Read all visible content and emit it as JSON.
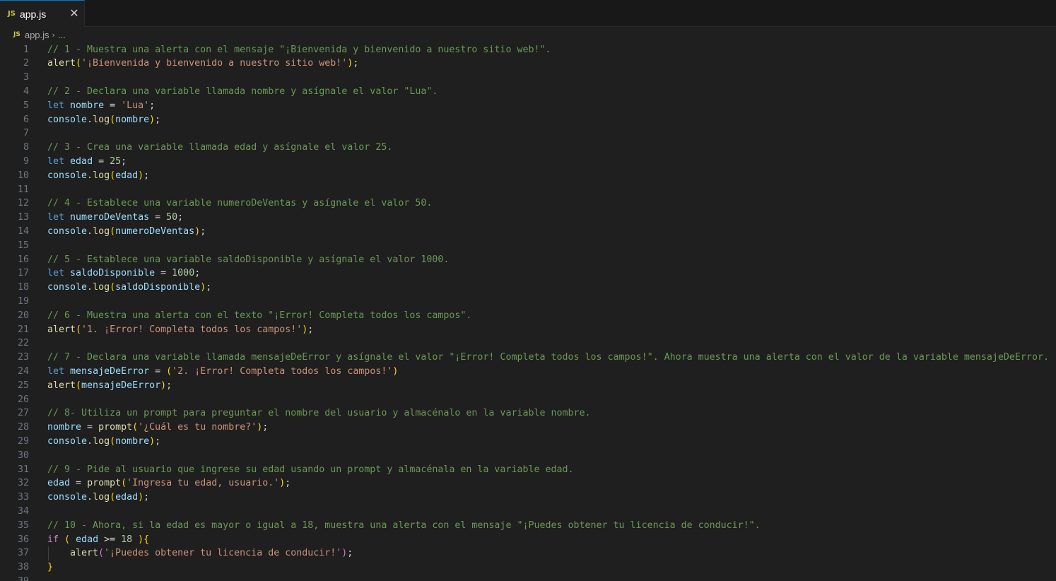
{
  "tab": {
    "badge": "JS",
    "filename": "app.js",
    "close": "✕"
  },
  "breadcrumb": {
    "badge": "JS",
    "file": "app.js",
    "separator": "›",
    "more": "..."
  },
  "code_lines": [
    {
      "n": "1",
      "tokens": [
        [
          "cm",
          "// 1 - Muestra una alerta con el mensaje \"¡Bienvenida y bienvenido a nuestro sitio web!\"."
        ]
      ]
    },
    {
      "n": "2",
      "tokens": [
        [
          "fn",
          "alert"
        ],
        [
          "b1",
          "("
        ],
        [
          "str",
          "'¡Bienvenida y bienvenido a nuestro sitio web!'"
        ],
        [
          "b1",
          ")"
        ],
        [
          "op",
          ";"
        ]
      ]
    },
    {
      "n": "3",
      "tokens": []
    },
    {
      "n": "4",
      "tokens": [
        [
          "cm",
          "// 2 - Declara una variable llamada nombre y asígnale el valor \"Lua\"."
        ]
      ]
    },
    {
      "n": "5",
      "tokens": [
        [
          "kw",
          "let"
        ],
        [
          "op",
          " "
        ],
        [
          "var",
          "nombre"
        ],
        [
          "op",
          " = "
        ],
        [
          "str",
          "'Lua'"
        ],
        [
          "op",
          ";"
        ]
      ]
    },
    {
      "n": "6",
      "tokens": [
        [
          "var",
          "console"
        ],
        [
          "op",
          "."
        ],
        [
          "fn",
          "log"
        ],
        [
          "b1",
          "("
        ],
        [
          "var",
          "nombre"
        ],
        [
          "b1",
          ")"
        ],
        [
          "op",
          ";"
        ]
      ]
    },
    {
      "n": "7",
      "tokens": []
    },
    {
      "n": "8",
      "tokens": [
        [
          "cm",
          "// 3 - Crea una variable llamada edad y asígnale el valor 25."
        ]
      ]
    },
    {
      "n": "9",
      "tokens": [
        [
          "kw",
          "let"
        ],
        [
          "op",
          " "
        ],
        [
          "var",
          "edad"
        ],
        [
          "op",
          " = "
        ],
        [
          "num",
          "25"
        ],
        [
          "op",
          ";"
        ]
      ]
    },
    {
      "n": "10",
      "tokens": [
        [
          "var",
          "console"
        ],
        [
          "op",
          "."
        ],
        [
          "fn",
          "log"
        ],
        [
          "b1",
          "("
        ],
        [
          "var",
          "edad"
        ],
        [
          "b1",
          ")"
        ],
        [
          "op",
          ";"
        ]
      ]
    },
    {
      "n": "11",
      "tokens": []
    },
    {
      "n": "12",
      "tokens": [
        [
          "cm",
          "// 4 - Establece una variable numeroDeVentas y asígnale el valor 50."
        ]
      ]
    },
    {
      "n": "13",
      "tokens": [
        [
          "kw",
          "let"
        ],
        [
          "op",
          " "
        ],
        [
          "var",
          "numeroDeVentas"
        ],
        [
          "op",
          " = "
        ],
        [
          "num",
          "50"
        ],
        [
          "op",
          ";"
        ]
      ]
    },
    {
      "n": "14",
      "tokens": [
        [
          "var",
          "console"
        ],
        [
          "op",
          "."
        ],
        [
          "fn",
          "log"
        ],
        [
          "b1",
          "("
        ],
        [
          "var",
          "numeroDeVentas"
        ],
        [
          "b1",
          ")"
        ],
        [
          "op",
          ";"
        ]
      ]
    },
    {
      "n": "15",
      "tokens": []
    },
    {
      "n": "16",
      "tokens": [
        [
          "cm",
          "// 5 - Establece una variable saldoDisponible y asígnale el valor 1000."
        ]
      ]
    },
    {
      "n": "17",
      "tokens": [
        [
          "kw",
          "let"
        ],
        [
          "op",
          " "
        ],
        [
          "var",
          "saldoDisponible"
        ],
        [
          "op",
          " = "
        ],
        [
          "num",
          "1000"
        ],
        [
          "op",
          ";"
        ]
      ]
    },
    {
      "n": "18",
      "tokens": [
        [
          "var",
          "console"
        ],
        [
          "op",
          "."
        ],
        [
          "fn",
          "log"
        ],
        [
          "b1",
          "("
        ],
        [
          "var",
          "saldoDisponible"
        ],
        [
          "b1",
          ")"
        ],
        [
          "op",
          ";"
        ]
      ]
    },
    {
      "n": "19",
      "tokens": []
    },
    {
      "n": "20",
      "tokens": [
        [
          "cm",
          "// 6 - Muestra una alerta con el texto \"¡Error! Completa todos los campos\"."
        ]
      ]
    },
    {
      "n": "21",
      "tokens": [
        [
          "fn",
          "alert"
        ],
        [
          "b1",
          "("
        ],
        [
          "str",
          "'1. ¡Error! Completa todos los campos!'"
        ],
        [
          "b1",
          ")"
        ],
        [
          "op",
          ";"
        ]
      ]
    },
    {
      "n": "22",
      "tokens": []
    },
    {
      "n": "23",
      "tokens": [
        [
          "cm",
          "// 7 - Declara una variable llamada mensajeDeError y asígnale el valor \"¡Error! Completa todos los campos!\". Ahora muestra una alerta con el valor de la variable mensajeDeError."
        ]
      ]
    },
    {
      "n": "24",
      "tokens": [
        [
          "kw",
          "let"
        ],
        [
          "op",
          " "
        ],
        [
          "var",
          "mensajeDeError"
        ],
        [
          "op",
          " = "
        ],
        [
          "b1",
          "("
        ],
        [
          "str",
          "'2. ¡Error! Completa todos los campos!'"
        ],
        [
          "b1",
          ")"
        ]
      ]
    },
    {
      "n": "25",
      "tokens": [
        [
          "fn",
          "alert"
        ],
        [
          "b1",
          "("
        ],
        [
          "var",
          "mensajeDeError"
        ],
        [
          "b1",
          ")"
        ],
        [
          "op",
          ";"
        ]
      ]
    },
    {
      "n": "26",
      "tokens": []
    },
    {
      "n": "27",
      "tokens": [
        [
          "cm",
          "// 8- Utiliza un prompt para preguntar el nombre del usuario y almacénalo en la variable nombre."
        ]
      ]
    },
    {
      "n": "28",
      "tokens": [
        [
          "var",
          "nombre"
        ],
        [
          "op",
          " = "
        ],
        [
          "fn",
          "prompt"
        ],
        [
          "b1",
          "("
        ],
        [
          "str",
          "'¿Cuál es tu nombre?'"
        ],
        [
          "b1",
          ")"
        ],
        [
          "op",
          ";"
        ]
      ]
    },
    {
      "n": "29",
      "tokens": [
        [
          "var",
          "console"
        ],
        [
          "op",
          "."
        ],
        [
          "fn",
          "log"
        ],
        [
          "b1",
          "("
        ],
        [
          "var",
          "nombre"
        ],
        [
          "b1",
          ")"
        ],
        [
          "op",
          ";"
        ]
      ]
    },
    {
      "n": "30",
      "tokens": []
    },
    {
      "n": "31",
      "tokens": [
        [
          "cm",
          "// 9 - Pide al usuario que ingrese su edad usando un prompt y almacénala en la variable edad."
        ]
      ]
    },
    {
      "n": "32",
      "tokens": [
        [
          "var",
          "edad"
        ],
        [
          "op",
          " = "
        ],
        [
          "fn",
          "prompt"
        ],
        [
          "b1",
          "("
        ],
        [
          "str",
          "'Ingresa tu edad, usuario.'"
        ],
        [
          "b1",
          ")"
        ],
        [
          "op",
          ";"
        ]
      ]
    },
    {
      "n": "33",
      "tokens": [
        [
          "var",
          "console"
        ],
        [
          "op",
          "."
        ],
        [
          "fn",
          "log"
        ],
        [
          "b1",
          "("
        ],
        [
          "var",
          "edad"
        ],
        [
          "b1",
          ")"
        ],
        [
          "op",
          ";"
        ]
      ]
    },
    {
      "n": "34",
      "tokens": []
    },
    {
      "n": "35",
      "tokens": [
        [
          "cm",
          "// 10 - Ahora, si la edad es mayor o igual a 18, muestra una alerta con el mensaje \"¡Puedes obtener tu licencia de conducir!\"."
        ]
      ]
    },
    {
      "n": "36",
      "tokens": [
        [
          "ctl",
          "if"
        ],
        [
          "op",
          " "
        ],
        [
          "b1",
          "("
        ],
        [
          "op",
          " "
        ],
        [
          "var",
          "edad"
        ],
        [
          "op",
          " >= "
        ],
        [
          "num",
          "18"
        ],
        [
          "op",
          " "
        ],
        [
          "b1",
          ")"
        ],
        [
          "b1",
          "{"
        ]
      ]
    },
    {
      "n": "37",
      "indent": true,
      "tokens": [
        [
          "fn",
          "alert"
        ],
        [
          "b2",
          "("
        ],
        [
          "str",
          "'¡Puedes obtener tu licencia de conducir!'"
        ],
        [
          "b2",
          ")"
        ],
        [
          "op",
          ";"
        ]
      ]
    },
    {
      "n": "38",
      "tokens": [
        [
          "b1",
          "}"
        ]
      ]
    },
    {
      "n": "39",
      "tokens": []
    }
  ]
}
